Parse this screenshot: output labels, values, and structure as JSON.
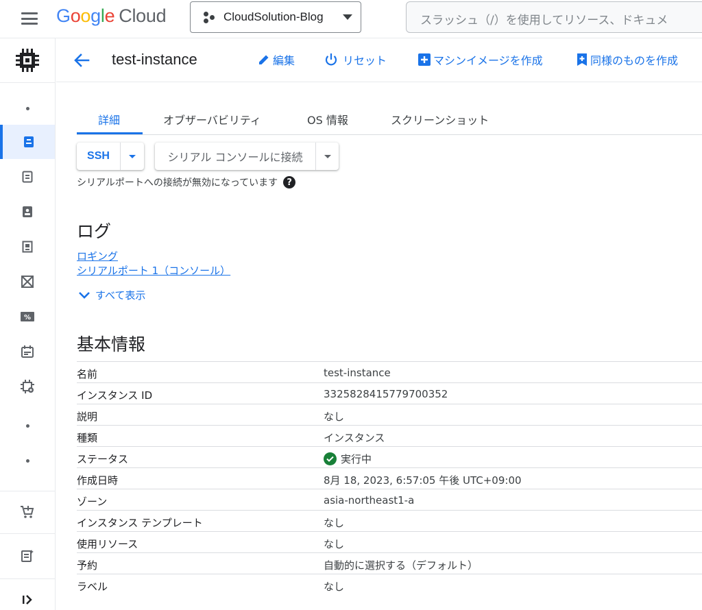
{
  "topbar": {
    "logo_letters": [
      "G",
      "o",
      "o",
      "g",
      "l",
      "e"
    ],
    "logo_suffix": "Cloud",
    "project": "CloudSolution-Blog",
    "search_placeholder": "スラッシュ（/）を使用してリソース、ドキュメ"
  },
  "header": {
    "title": "test-instance",
    "actions": {
      "edit": "編集",
      "reset": "リセット",
      "machine_image": "マシンイメージを作成",
      "create_similar": "同様のものを作成"
    }
  },
  "tabs": [
    "詳細",
    "オブザーバビリティ",
    "OS 情報",
    "スクリーンショット"
  ],
  "connect": {
    "ssh": "SSH",
    "serial": "シリアル コンソールに接続",
    "serial_note": "シリアルポートへの接続が無効になっています",
    "help_glyph": "?"
  },
  "logs": {
    "title": "ログ",
    "links": [
      "ロギング",
      "シリアルポート 1（コンソール）"
    ],
    "show_all": "すべて表示"
  },
  "basic_info": {
    "title": "基本情報",
    "rows": [
      {
        "key": "名前",
        "value": "test-instance"
      },
      {
        "key": "インスタンス ID",
        "value": "3325828415779700352"
      },
      {
        "key": "説明",
        "value": "なし"
      },
      {
        "key": "種類",
        "value": "インスタンス"
      },
      {
        "key": "ステータス",
        "value": "実行中",
        "status_icon": "check-circle-icon",
        "status_color": "#188038"
      },
      {
        "key": "作成日時",
        "value": "8月 18, 2023, 6:57:05 午後 UTC+09:00"
      },
      {
        "key": "ゾーン",
        "value": "asia-northeast1-a"
      },
      {
        "key": "インスタンス テンプレート",
        "value": "なし"
      },
      {
        "key": "使用リソース",
        "value": "なし"
      },
      {
        "key": "予約",
        "value": "自動的に選択する（デフォルト）"
      },
      {
        "key": "ラベル",
        "value": "なし"
      }
    ]
  },
  "colors": {
    "accent": "#1a73e8",
    "text": "#202124",
    "border": "#dadce0",
    "success": "#188038"
  }
}
